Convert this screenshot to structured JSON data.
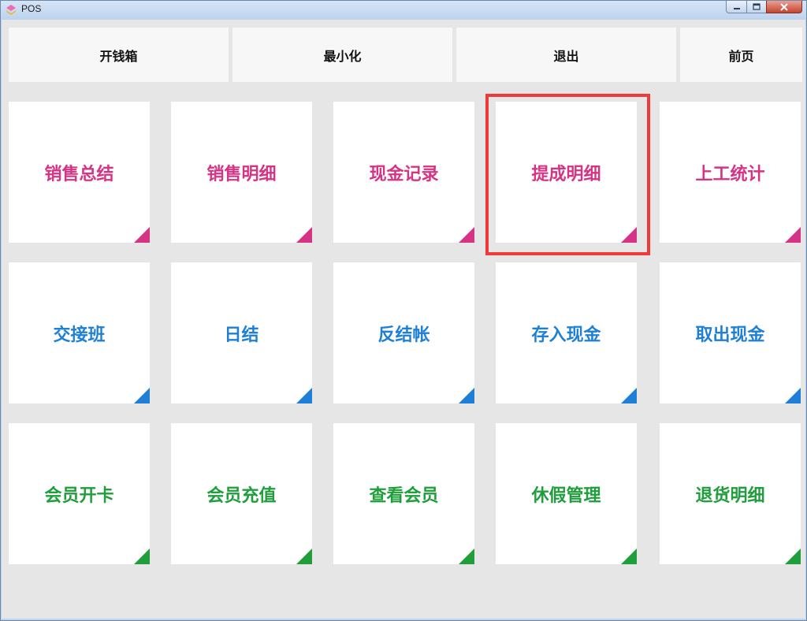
{
  "window": {
    "title": "POS",
    "icon": "app-logo-icon",
    "controls": [
      "minimize-icon",
      "maximize-icon",
      "close-icon"
    ]
  },
  "toolbar": {
    "open_drawer": "开钱箱",
    "minimize": "最小化",
    "exit": "退出",
    "home": "前页"
  },
  "colors": {
    "row1": "#d63384",
    "row2": "#1e7fd6",
    "row3": "#1f9e3b",
    "highlight": "#ee3a3a"
  },
  "tiles": {
    "row1": [
      "销售总结",
      "销售明细",
      "现金记录",
      "提成明细",
      "上工统计"
    ],
    "row2": [
      "交接班",
      "日结",
      "反结帐",
      "存入现金",
      "取出现金"
    ],
    "row3": [
      "会员开卡",
      "会员充值",
      "查看会员",
      "休假管理",
      "退货明细"
    ]
  }
}
